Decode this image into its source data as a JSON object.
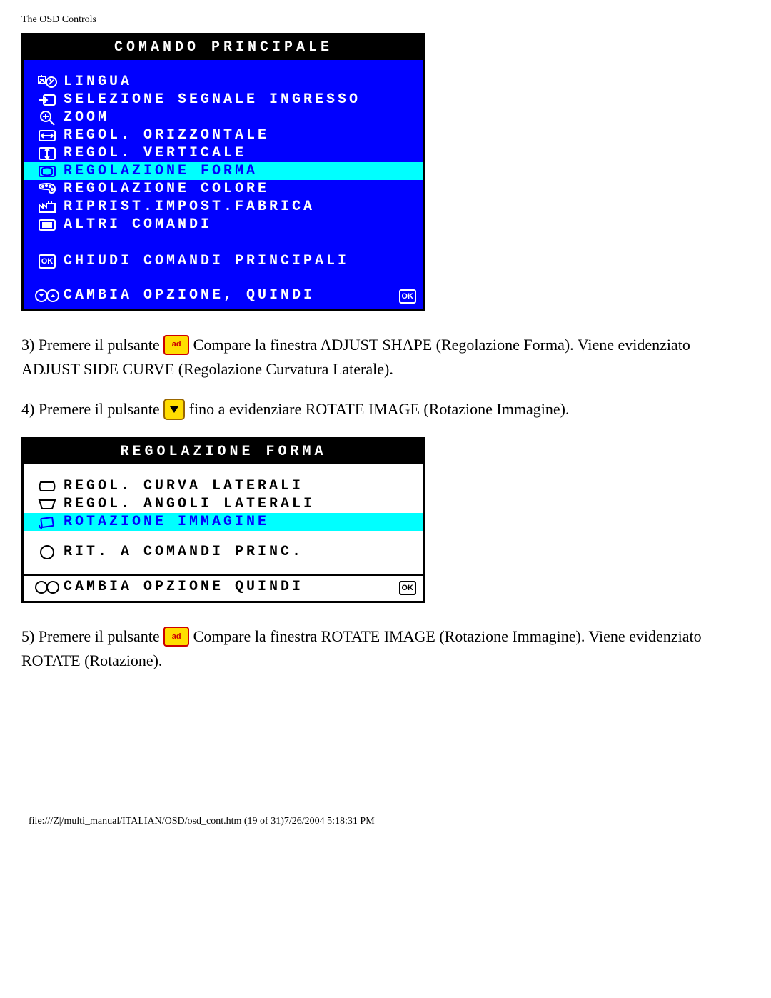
{
  "page_header": "The OSD Controls",
  "menu1": {
    "title": "COMANDO PRINCIPALE",
    "items": [
      {
        "label": "LINGUA",
        "icon": "lang"
      },
      {
        "label": "SELEZIONE SEGNALE INGRESSO",
        "icon": "input"
      },
      {
        "label": "ZOOM",
        "icon": "zoom"
      },
      {
        "label": "REGOL. ORIZZONTALE",
        "icon": "horiz"
      },
      {
        "label": "REGOL. VERTICALE",
        "icon": "vert"
      },
      {
        "label": "REGOLAZIONE FORMA",
        "icon": "shape",
        "selected": true
      },
      {
        "label": "REGOLAZIONE COLORE",
        "icon": "color"
      },
      {
        "label": "RIPRIST.IMPOST.FABRICA",
        "icon": "factory"
      },
      {
        "label": "ALTRI COMANDI",
        "icon": "extra"
      }
    ],
    "close_label": "CHIUDI COMANDI PRINCIPALI",
    "footer_label": "CAMBIA OPZIONE, QUINDI"
  },
  "step3": {
    "pre": "3) Premere il pulsante ",
    "post": " Compare la finestra ADJUST SHAPE (Regolazione Forma). Viene evidenziato ADJUST SIDE CURVE (Regolazione Curvatura Laterale)."
  },
  "step4": {
    "pre": "4) Premere il pulsante ",
    "post": " fino a evidenziare ROTATE IMAGE (Rotazione Immagine)."
  },
  "menu2": {
    "title": "REGOLAZIONE FORMA",
    "items": [
      {
        "label": "REGOL. CURVA LATERALI",
        "icon": "sidecurve"
      },
      {
        "label": "REGOL. ANGOLI LATERALI",
        "icon": "sideangle"
      },
      {
        "label": "ROTAZIONE IMMAGINE",
        "icon": "rotate",
        "selected": true
      }
    ],
    "back_label": "RIT. A COMANDI PRINC.",
    "footer_label": "CAMBIA OPZIONE QUINDI"
  },
  "step5": {
    "pre": "5) Premere il pulsante ",
    "post": " Compare la finestra ROTATE IMAGE (Rotazione Immagine). Viene evidenziato ROTATE (Rotazione)."
  },
  "footer_path": "file:///Z|/multi_manual/ITALIAN/OSD/osd_cont.htm (19 of 31)7/26/2004 5:18:31 PM"
}
